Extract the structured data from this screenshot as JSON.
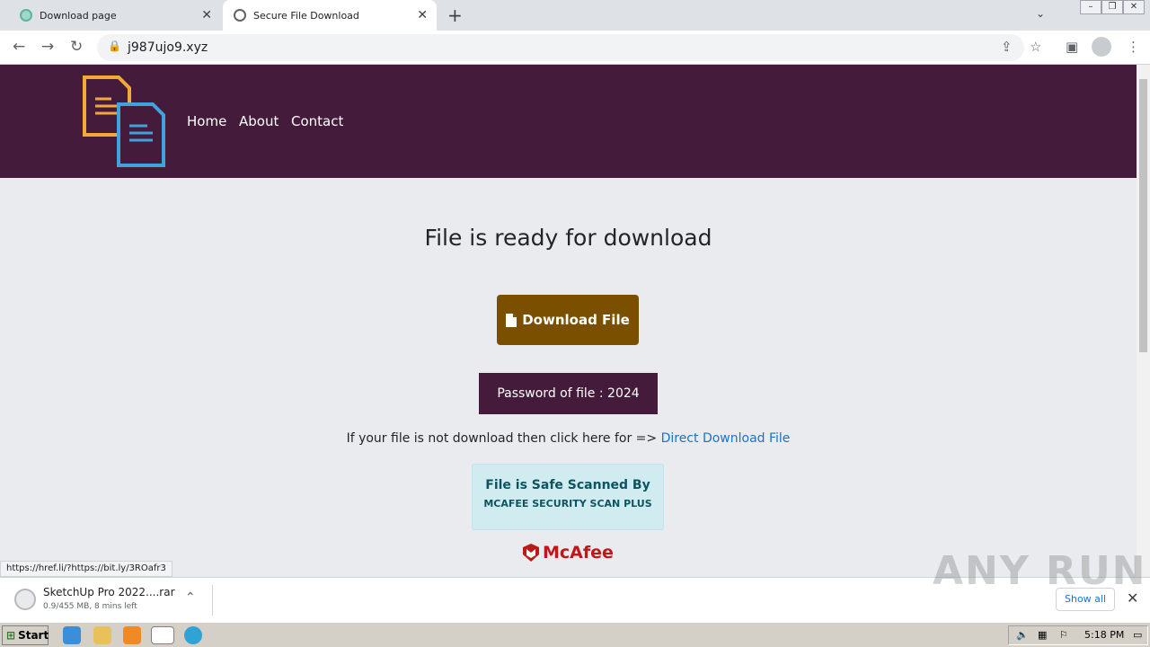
{
  "browser": {
    "tabs": [
      {
        "title": "Download page"
      },
      {
        "title": "Secure File Download"
      }
    ],
    "url": "j987ujo9.xyz",
    "status_url": "https://href.li/?https://bit.ly/3ROafr3"
  },
  "site": {
    "nav": [
      "Home",
      "About",
      "Contact"
    ],
    "heading": "File is ready for download",
    "download_button": "Download File",
    "password_text": "Password of file : 2024",
    "hint_prefix": "If your file is not download then click here for => ",
    "hint_link": "Direct Download File",
    "safe_title": "File is Safe Scanned By",
    "safe_sub": "MCAFEE SECURITY SCAN PLUS",
    "brand": "McAfee"
  },
  "downloads": {
    "file_name": "SketchUp Pro 2022....rar",
    "progress": "0.9/455 MB, 8 mins left",
    "show_all": "Show all"
  },
  "watermark": "ANY RUN",
  "taskbar": {
    "start": "Start",
    "clock": "5:18 PM"
  },
  "colors": {
    "header": "#451b3c",
    "download_button": "#7a5000",
    "link": "#1a73c8",
    "safe_box": "#d1ecf1",
    "mcafee": "#c01818"
  }
}
